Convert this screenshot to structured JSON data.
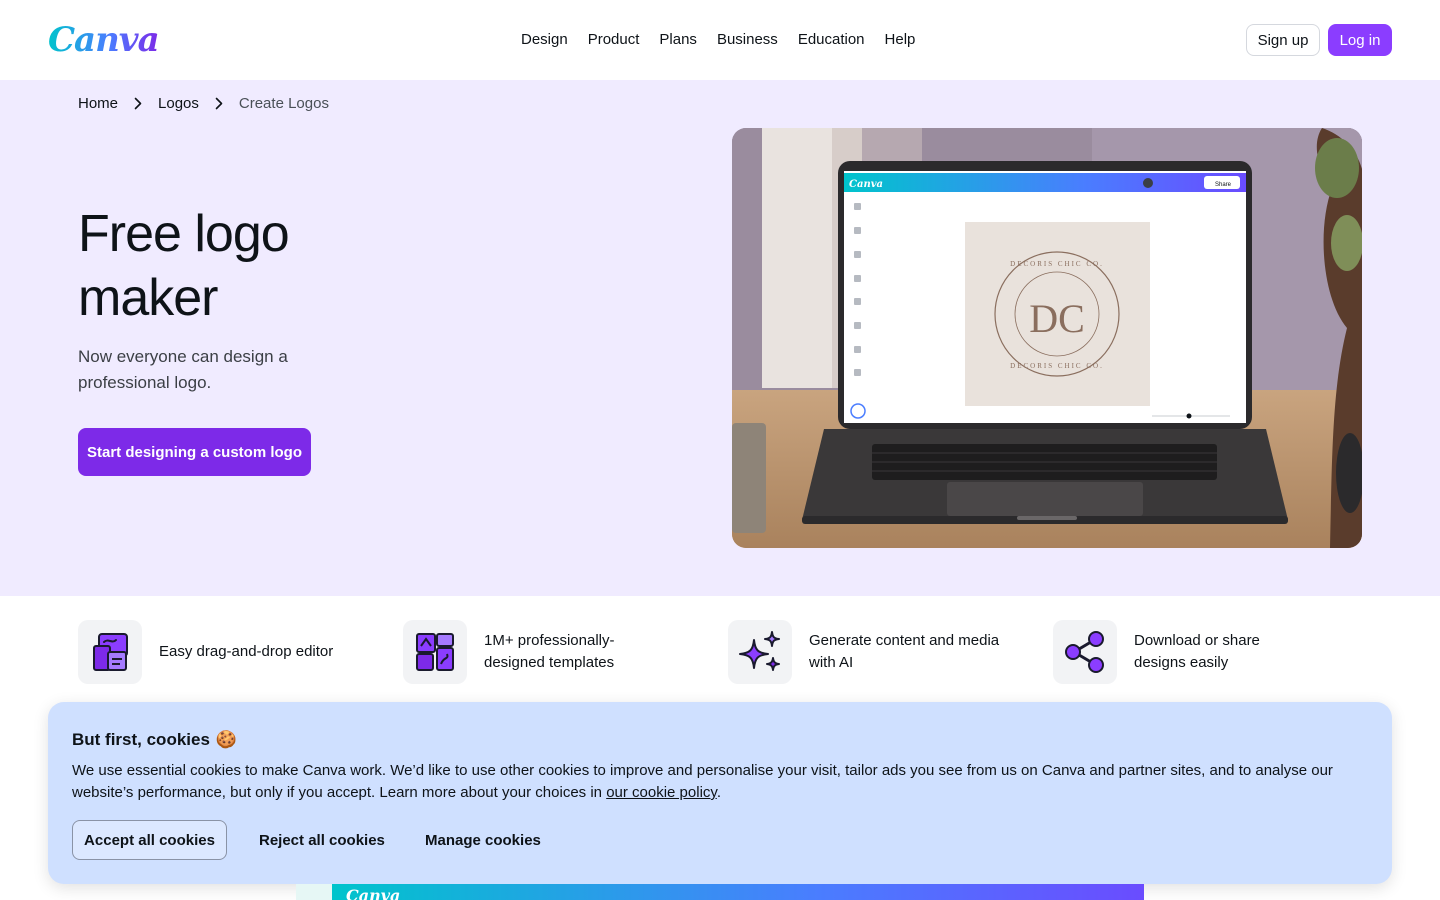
{
  "header": {
    "logo": "Canva",
    "nav": [
      "Design",
      "Product",
      "Plans",
      "Business",
      "Education",
      "Help"
    ],
    "signup_label": "Sign up",
    "login_label": "Log in",
    "brand_color": "#8b3dff"
  },
  "hero": {
    "breadcrumb": [
      "Home",
      "Logos",
      "Create Logos"
    ],
    "title": "Free logo maker",
    "subtitle": "Now everyone can design a professional logo.",
    "cta_label": "Start designing a custom logo",
    "cta_color": "#7d2ae8",
    "background_color": "#f0ebff",
    "image": {
      "app_logo": "Canva",
      "share_label": "Share",
      "logo_text_top": "DECORIS CHIC CO.",
      "logo_text_bottom": "DECORIS CHIC CO.",
      "monogram": "DC"
    }
  },
  "features": [
    {
      "icon": "drag-drop-editor-icon",
      "text": "Easy drag-and-drop editor"
    },
    {
      "icon": "templates-icon",
      "text": "1M+ professionally-designed templates"
    },
    {
      "icon": "ai-sparkles-icon",
      "text": "Generate content and media with AI"
    },
    {
      "icon": "share-icon",
      "text": "Download or share designs easily"
    }
  ],
  "cookie_banner": {
    "title": "But first, cookies",
    "emoji": "🍪",
    "text": "We use essential cookies to make Canva work. We’d like to use other cookies to improve and personalise your visit, tailor ads you see from us on Canva and partner sites, and to analyse our website’s performance, but only if you accept. Learn more about your choices in",
    "link": "our cookie policy",
    "text_end": ".",
    "accept_label": "Accept all cookies",
    "reject_label": "Reject all cookies",
    "manage_label": "Manage cookies",
    "background_color": "#cfe0ff"
  },
  "peek": {
    "app_logo": "Canva"
  }
}
